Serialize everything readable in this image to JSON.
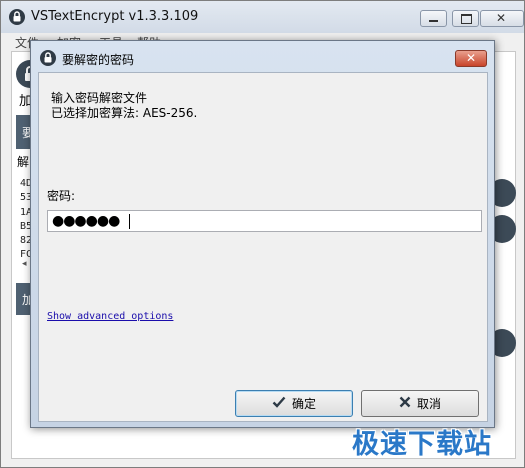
{
  "main_window": {
    "title": "VSTextEncrypt v1.3.3.109",
    "menu": [
      "文件",
      "加密",
      "工具",
      "帮助"
    ],
    "left_fragments": [
      "加",
      "要",
      "解",
      "加"
    ],
    "hex_lines": [
      "4D",
      "53",
      "1A",
      "B5",
      "82",
      "FC"
    ],
    "scroll_arrow": "◂"
  },
  "dialog": {
    "title": "要解密的密码",
    "close_glyph": "✕",
    "message_line1": "输入密码解密文件",
    "message_line2": "已选择加密算法: AES-256.",
    "password_label": "密码:",
    "password_value": "●●●●●●",
    "advanced_link": "Show advanced options",
    "ok_label": "确定",
    "cancel_label": "取消"
  },
  "icons": {
    "app": "lock-icon",
    "ok": "checkmark-icon",
    "cancel": "x-icon"
  },
  "colors": {
    "accent": "#3c7fb1",
    "close_red": "#c8442a",
    "watermark_blue": "#2a78c8"
  },
  "watermark": "极速下载站"
}
